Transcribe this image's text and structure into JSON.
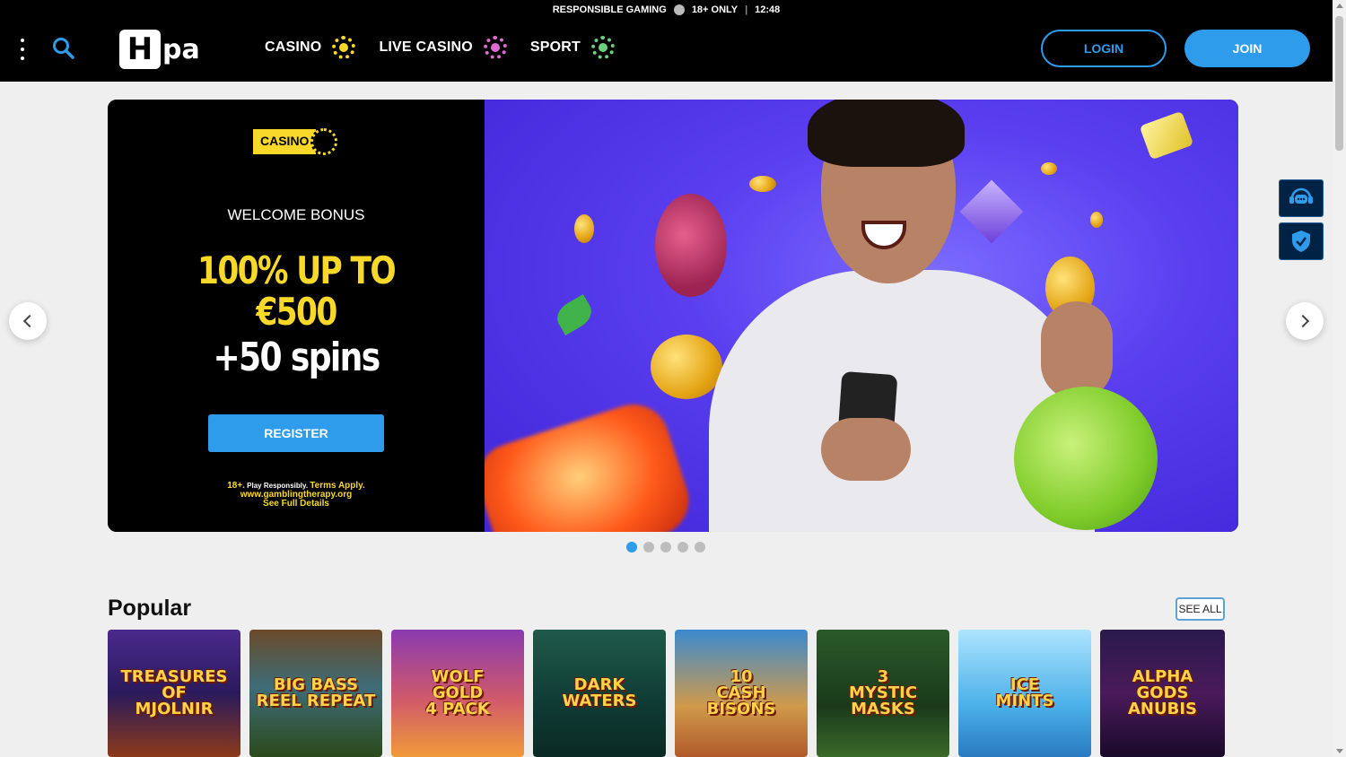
{
  "topbar": {
    "responsible": "RESPONSIBLE GAMING",
    "age": "18+ ONLY",
    "separator": "|",
    "time": "12:48"
  },
  "header": {
    "logo_h": "H",
    "logo_rest": "pa",
    "nav": [
      {
        "label": "CASINO",
        "chip_color": "#f8d92a"
      },
      {
        "label": "LIVE CASINO",
        "chip_color": "#e06bd0"
      },
      {
        "label": "SPORT",
        "chip_color": "#6bcf7f"
      }
    ],
    "login_label": "LOGIN",
    "join_label": "JOIN"
  },
  "banner": {
    "badge": "CASINO",
    "welcome": "WELCOME BONUS",
    "bonus_line1": "100% UP TO",
    "bonus_line2": "€500",
    "spins": "+50 spins",
    "register_label": "REGISTER",
    "disclaimer_a": "18+.",
    "disclaimer_b": " Play Responsibly. ",
    "disclaimer_c": "Terms Apply.",
    "disclaimer_d": "www.gamblingtherapy.org",
    "disclaimer_e": "See Full Details",
    "slides_total": 5,
    "slide_active": 1
  },
  "popular": {
    "title": "Popular",
    "see_all": "SEE ALL",
    "games": [
      {
        "title": "TREASURES OF\nMJOLNIR",
        "bg": "linear-gradient(180deg,#4a2a8c,#2a1a5c 50%,#8c3a1a)"
      },
      {
        "title": "BIG BASS\nREEL REPEAT",
        "bg": "linear-gradient(180deg,#6a4a2a,#3f6c78 45%,#2a4a1a)"
      },
      {
        "title": "WOLF\nGOLD\n4 PACK",
        "bg": "linear-gradient(180deg,#8a3ab0,#d05a6a 55%,#f09a3a)"
      },
      {
        "title": "DARK\nWATERS",
        "bg": "linear-gradient(180deg,#1f5a4a,#0f3a34 60%,#0a2a24)"
      },
      {
        "title": "10\nCASH\nBISONS",
        "bg": "linear-gradient(180deg,#3a8ad0,#d09a4a 60%,#b05a2a)"
      },
      {
        "title": "3\nMYSTIC\nMASKS",
        "bg": "linear-gradient(180deg,#2a5a2a,#1a3a1a 60%,#3a6a2a)"
      },
      {
        "title": "ICE\nMINTS",
        "bg": "linear-gradient(180deg,#aee4ff,#4ab0e8 60%,#2a7ac0)"
      },
      {
        "title": "ALPHA GODS\nANUBIS",
        "bg": "linear-gradient(180deg,#2a1a4a,#4a1a5a 50%,#1a0a2a)"
      }
    ]
  },
  "colors": {
    "accent": "#2f9ceb",
    "brand_yellow": "#f8d92a",
    "header_bg": "#000000",
    "page_bg": "#efefef"
  },
  "icons": {
    "menu": "kebab-icon",
    "search": "search-icon",
    "chat": "chat-support-icon",
    "shield": "shield-icon",
    "prev": "chevron-left-icon",
    "next": "chevron-right-icon"
  }
}
